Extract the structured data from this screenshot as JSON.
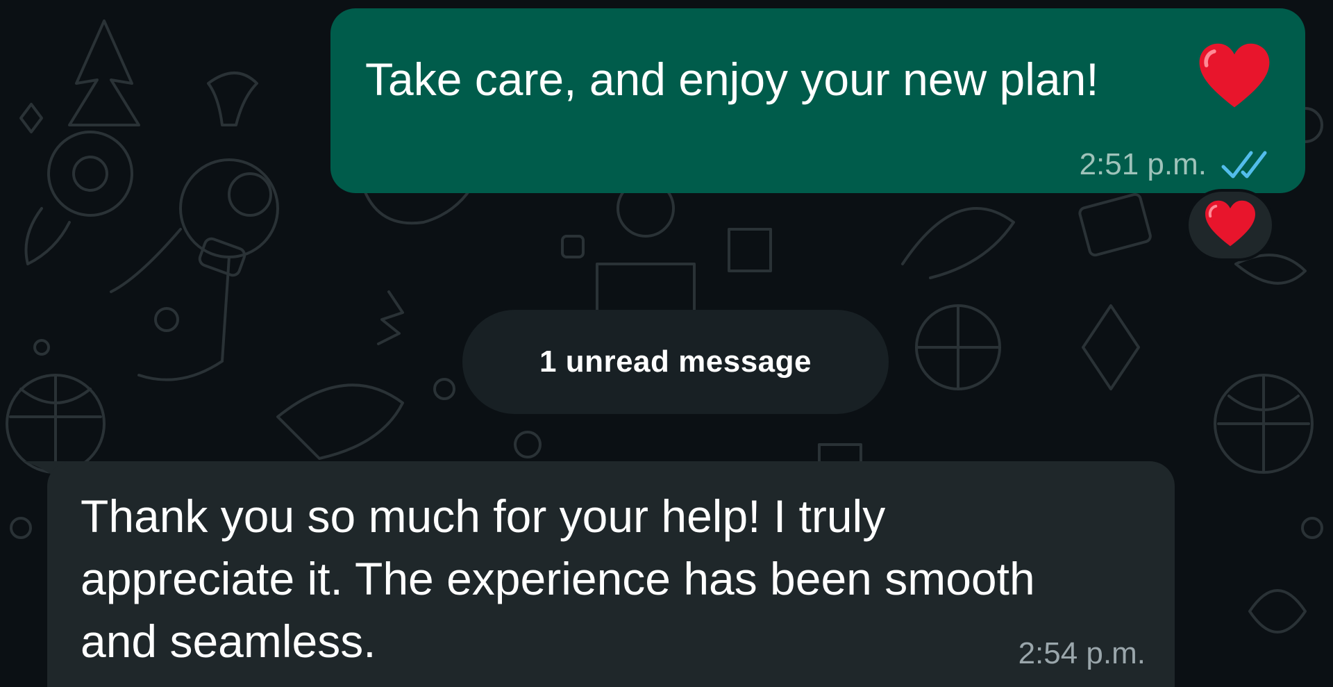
{
  "messages": {
    "outgoing": {
      "text": "Take care, and enjoy your new plan!",
      "emoji": "heart-emoji",
      "time": "2:51 p.m.",
      "status_icon": "double-check-read-icon",
      "status_color": "#53bdeb",
      "reaction": "heart-emoji",
      "bubble_color": "#005c4b"
    },
    "incoming": {
      "text": "Thank you so much for your help! I truly appreciate it. The experience has been smooth and seamless.",
      "time": "2:54 p.m.",
      "bubble_color": "#1f272a"
    }
  },
  "divider": {
    "unread_label": "1 unread message"
  },
  "colors": {
    "background": "#0b1014",
    "heart": "#e8152c"
  }
}
